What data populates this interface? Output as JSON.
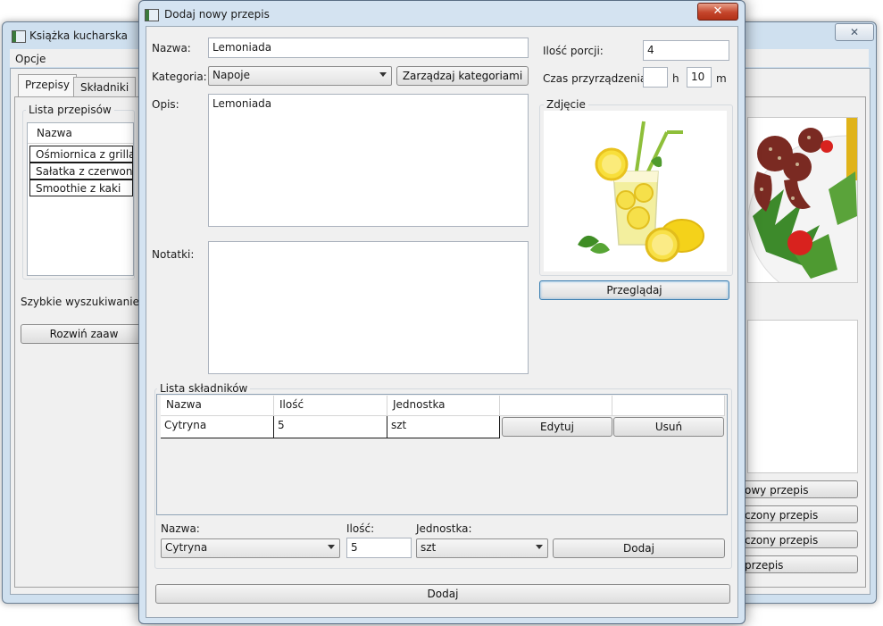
{
  "main_window": {
    "title": "Książka kucharska",
    "menu": "Opcje",
    "tabs": [
      "Przepisy",
      "Składniki"
    ],
    "recipes_group": "Lista przepisów",
    "recipes_column": "Nazwa",
    "recipes": [
      "Ośmiornica z grilla",
      "Sałatka z czerwoną c",
      "Smoothie z kaki"
    ],
    "quick_search_label": "Szybkie wyszukiwanie:",
    "expand_button": "Rozwiń zaaw",
    "side_buttons": [
      "owy przepis",
      "czony przepis",
      "czony przepis",
      "przepis"
    ]
  },
  "dialog": {
    "title": "Dodaj nowy przepis",
    "name_label": "Nazwa:",
    "name_value": "Lemoniada",
    "category_label": "Kategoria:",
    "category_value": "Napoje",
    "manage_categories_button": "Zarządzaj kategoriami",
    "description_label": "Opis:",
    "description_value": "Lemoniada",
    "notes_label": "Notatki:",
    "notes_value": "",
    "portions_label": "Ilość porcji:",
    "portions_value": "4",
    "prep_time_label": "Czas przyrządzenia:",
    "prep_hours_value": "",
    "hours_unit": "h",
    "prep_minutes_value": "10",
    "minutes_unit": "m",
    "photo_group": "Zdjęcie",
    "browse_button": "Przeglądaj",
    "ingredients_group": "Lista składników",
    "grid_headers": [
      "Nazwa",
      "Ilość",
      "Jednostka"
    ],
    "grid_rows": [
      {
        "name": "Cytryna",
        "qty": "5",
        "unit": "szt",
        "edit": "Edytuj",
        "delete": "Usuń"
      }
    ],
    "new_ing_name_label": "Nazwa:",
    "new_ing_name_value": "Cytryna",
    "new_ing_qty_label": "Ilość:",
    "new_ing_qty_value": "5",
    "new_ing_unit_label": "Jednostka:",
    "new_ing_unit_value": "szt",
    "add_ingredient_button": "Dodaj",
    "add_recipe_button": "Dodaj",
    "close_glyph": "✕"
  },
  "colors": {
    "window_frame": "#d4e3f1",
    "close_button": "#c4452b",
    "selected_button_border": "#3c7fb1"
  }
}
